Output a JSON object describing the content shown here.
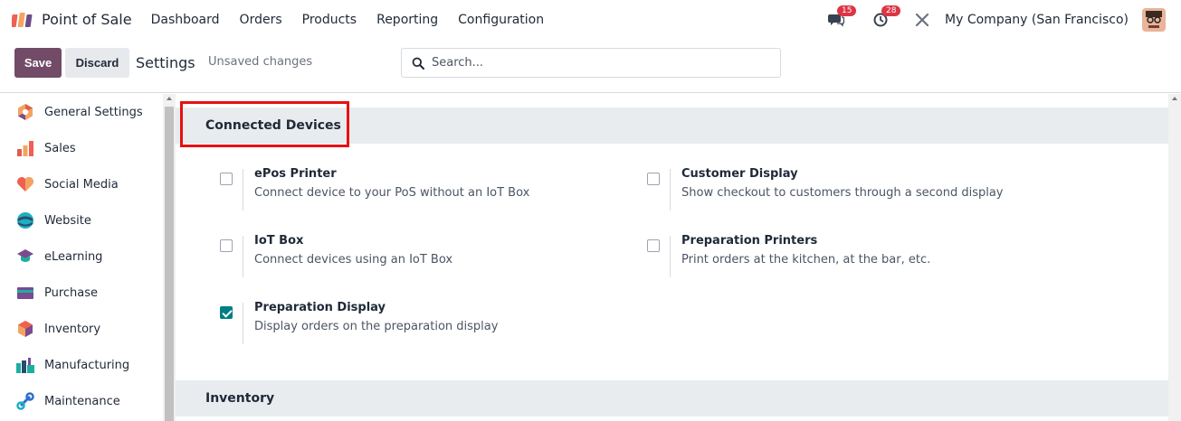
{
  "navbar": {
    "app_name": "Point of Sale",
    "menu": [
      "Dashboard",
      "Orders",
      "Products",
      "Reporting",
      "Configuration"
    ],
    "messages_count": "15",
    "activities_count": "28",
    "company": "My Company (San Francisco)"
  },
  "control_panel": {
    "save_label": "Save",
    "discard_label": "Discard",
    "title": "Settings",
    "status": "Unsaved changes",
    "search_placeholder": "Search..."
  },
  "sidebar": {
    "items": [
      {
        "label": "General Settings",
        "icon": "general-settings-icon"
      },
      {
        "label": "Sales",
        "icon": "sales-icon"
      },
      {
        "label": "Social Media",
        "icon": "social-media-icon"
      },
      {
        "label": "Website",
        "icon": "website-icon"
      },
      {
        "label": "eLearning",
        "icon": "elearning-icon"
      },
      {
        "label": "Purchase",
        "icon": "purchase-icon"
      },
      {
        "label": "Inventory",
        "icon": "inventory-icon"
      },
      {
        "label": "Manufacturing",
        "icon": "manufacturing-icon"
      },
      {
        "label": "Maintenance",
        "icon": "maintenance-icon"
      }
    ]
  },
  "sections": {
    "connected_devices": {
      "title": "Connected Devices",
      "settings": [
        {
          "title": "ePos Printer",
          "desc": "Connect device to your PoS without an IoT Box",
          "checked": false
        },
        {
          "title": "Customer Display",
          "desc": "Show checkout to customers through a second display",
          "checked": false
        },
        {
          "title": "IoT Box",
          "desc": "Connect devices using an IoT Box",
          "checked": false
        },
        {
          "title": "Preparation Printers",
          "desc": "Print orders at the kitchen, at the bar, etc.",
          "checked": false
        },
        {
          "title": "Preparation Display",
          "desc": "Display orders on the preparation display",
          "checked": true
        }
      ]
    },
    "inventory": {
      "title": "Inventory"
    }
  },
  "colors": {
    "brand": "#714b67",
    "checkbox_checked": "#017e84",
    "badge": "#dc3545",
    "highlight": "#e8100f",
    "section_bg": "#e9ecef"
  }
}
